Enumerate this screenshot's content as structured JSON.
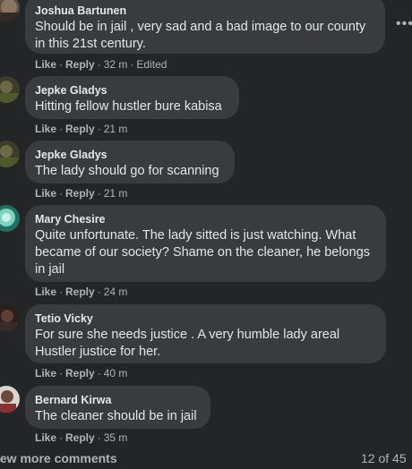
{
  "comments": [
    {
      "author": "Joshua Bartunen",
      "text": "Should be in jail , very sad and a bad image to our county in this 21st century.",
      "like": "Like",
      "reply": "Reply",
      "time": "32 m",
      "edited": "Edited"
    },
    {
      "author": "Jepke Gladys",
      "text": "Hitting fellow hustler bure kabisa",
      "like": "Like",
      "reply": "Reply",
      "time": "21 m"
    },
    {
      "author": "Jepke Gladys",
      "text": "The lady should go for scanning",
      "like": "Like",
      "reply": "Reply",
      "time": "21 m"
    },
    {
      "author": "Mary Chesire",
      "text": "Quite unfortunate. The lady sitted is just watching. What became of our society? Shame on the cleaner, he belongs in jail",
      "like": "Like",
      "reply": "Reply",
      "time": "24 m"
    },
    {
      "author": "Tetio Vicky",
      "text": "For sure she needs justice . A very humble lady areal Hustler justice for her.",
      "like": "Like",
      "reply": "Reply",
      "time": "40 m"
    },
    {
      "author": "Bernard Kirwa",
      "text": "The cleaner should be in jail",
      "like": "Like",
      "reply": "Reply",
      "time": "35 m"
    }
  ],
  "more_options_icon": "ellipsis-icon",
  "footer": {
    "view_more": "iew more comments",
    "count": "12 of 45"
  },
  "colors": {
    "background": "#242526",
    "bubble": "#3a3b3c",
    "text": "#e4e6eb",
    "secondary_text": "#b0b3b8"
  }
}
